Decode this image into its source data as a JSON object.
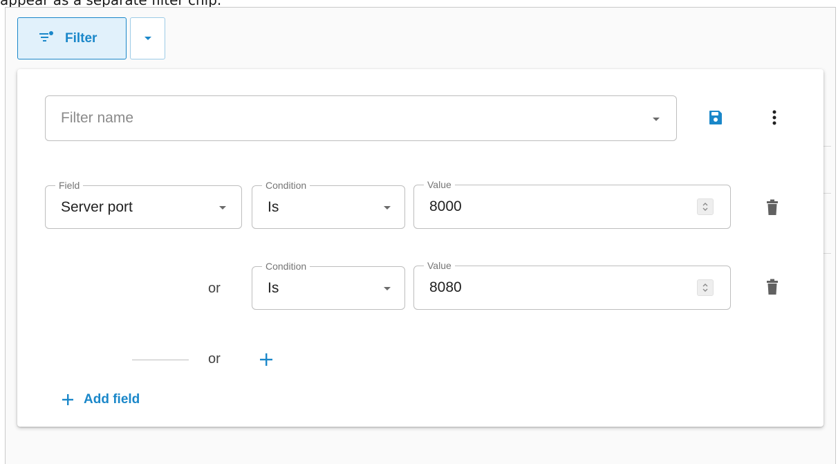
{
  "page": {
    "top_text": "appear as a separate filter chip."
  },
  "toolbar": {
    "filter_label": "Filter"
  },
  "filter_name": {
    "placeholder": "Filter name"
  },
  "rows": [
    {
      "field_legend": "Field",
      "field_value": "Server port",
      "condition_legend": "Condition",
      "condition_value": "Is",
      "value_legend": "Value",
      "value": "8000"
    },
    {
      "connector": "or",
      "condition_legend": "Condition",
      "condition_value": "Is",
      "value_legend": "Value",
      "value": "8080"
    }
  ],
  "add_row": {
    "connector": "or"
  },
  "add_field": {
    "label": "Add field"
  },
  "colors": {
    "accent": "#1a87c9",
    "icon_gray": "#5f5f5f"
  }
}
